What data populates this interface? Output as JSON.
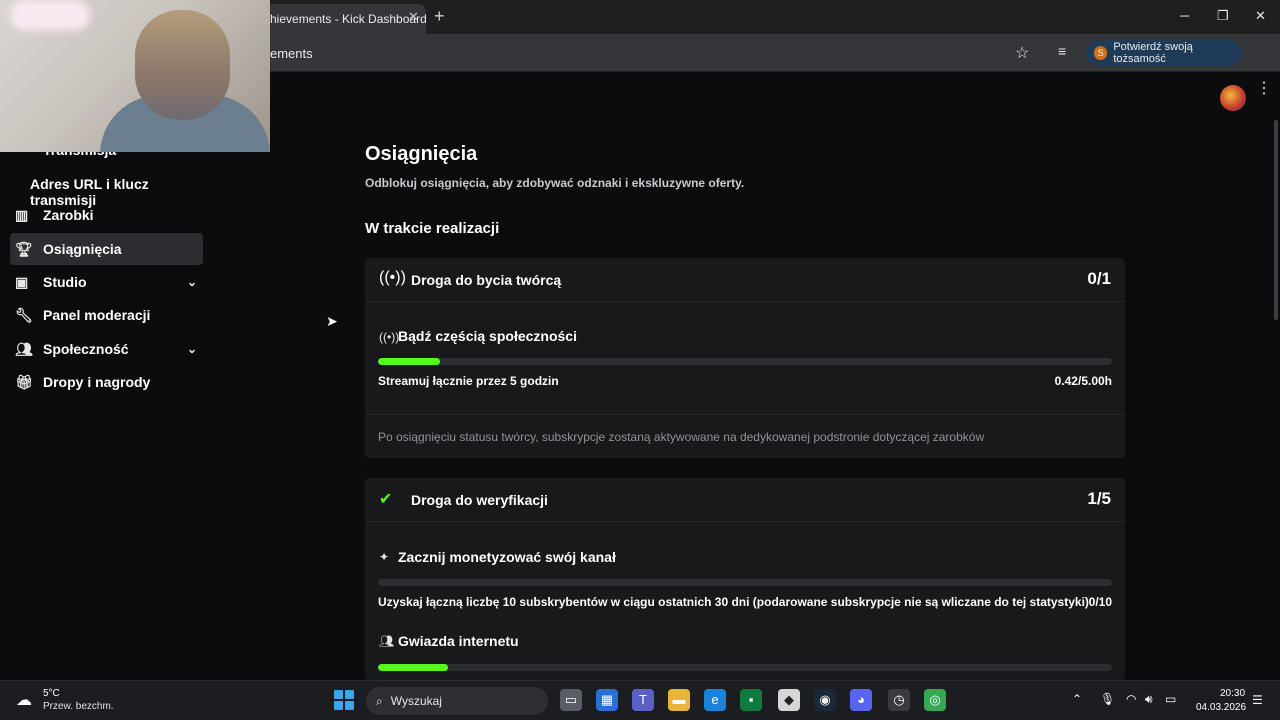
{
  "browser": {
    "tab_title": "hievements - Kick Dashboard",
    "url_fragment": "ements",
    "verify_button": "Potwierdź swoją tożsamość",
    "verify_badge": "S"
  },
  "sidebar": {
    "partial_item": "Transmisja",
    "sub_item": "Adres URL i klucz transmisji",
    "items": [
      {
        "label": "Zarobki",
        "icon": "chart-icon"
      },
      {
        "label": "Osiągnięcia",
        "icon": "trophy-icon",
        "active": true
      },
      {
        "label": "Studio",
        "icon": "studio-icon",
        "expandable": true
      },
      {
        "label": "Panel moderacji",
        "icon": "wrench-icon"
      },
      {
        "label": "Społeczność",
        "icon": "community-icon",
        "expandable": true
      },
      {
        "label": "Dropy i nagrody",
        "icon": "gift-icon"
      }
    ]
  },
  "main": {
    "title": "Osiągnięcia",
    "subtitle": "Odblokuj osiągnięcia, aby zdobywać odznaki i ekskluzywne oferty.",
    "section_heading": "W trakcie realizacji",
    "cards": [
      {
        "title": "Droga do bycia twórcą",
        "count": "0/1",
        "icon": "broadcast-icon",
        "tasks": [
          {
            "title": "Bądź częścią społeczności",
            "icon": "broadcast-icon",
            "description": "Streamuj łącznie przez 5 godzin",
            "value": "0.42/5.00h",
            "progress": 0.084
          }
        ],
        "note": "Po osiągnięciu statusu twórcy, subskrypcje zostaną aktywowane na dedykowanej podstronie dotyczącej zarobków"
      },
      {
        "title": "Droga do weryfikacji",
        "count": "1/5",
        "icon": "verified-icon",
        "tasks": [
          {
            "title": "Zacznij monetyzować swój kanał",
            "icon": "sparkle-icon",
            "description": "Uzyskaj łączną liczbę 10 subskrybentów w ciągu ostatnich 30 dni (podarowane subskrypcje nie są wliczane do tej statystyki)",
            "value": "0/10",
            "progress": 0
          },
          {
            "title": "Gwiazda internetu",
            "icon": "users-icon",
            "progress": 0.095
          }
        ]
      }
    ]
  },
  "taskbar": {
    "temperature": "5°C",
    "weather_desc": "Przew. bezchm.",
    "search_placeholder": "Wyszukaj",
    "time": "20:30",
    "date": "04.03.2026"
  },
  "colors": {
    "accent": "#53fc18",
    "background": "#0b0c0d",
    "card": "#18191b"
  }
}
